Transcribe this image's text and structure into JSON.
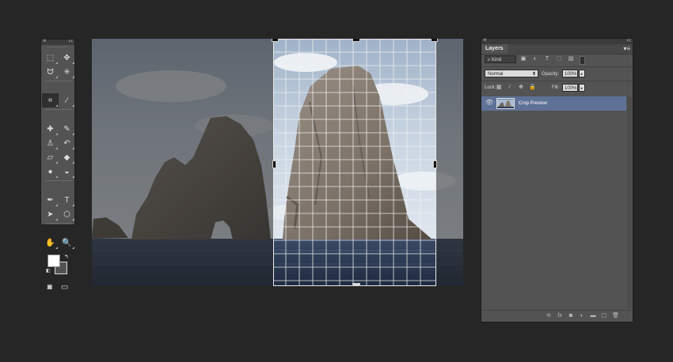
{
  "tools_panel": {
    "close_glyph": "×",
    "collapse_glyph": "‹‹",
    "tools": [
      {
        "name": "rectangular-marquee-tool",
        "glyph": "⬚"
      },
      {
        "name": "move-tool",
        "glyph": "✥"
      },
      {
        "name": "lasso-tool",
        "glyph": "ᗢ"
      },
      {
        "name": "magic-wand-tool",
        "glyph": "✳"
      },
      {
        "name": "crop-tool",
        "glyph": "⌗",
        "active": true
      },
      {
        "name": "eyedropper-tool",
        "glyph": "⁄"
      },
      {
        "name": "spot-healing-brush-tool",
        "glyph": "✚"
      },
      {
        "name": "brush-tool",
        "glyph": "✎"
      },
      {
        "name": "clone-stamp-tool",
        "glyph": "♙"
      },
      {
        "name": "history-brush-tool",
        "glyph": "↶"
      },
      {
        "name": "eraser-tool",
        "glyph": "▱"
      },
      {
        "name": "paint-bucket-tool",
        "glyph": "◆"
      },
      {
        "name": "blur-tool",
        "glyph": "●"
      },
      {
        "name": "dodge-tool",
        "glyph": "◒"
      },
      {
        "name": "pen-tool",
        "glyph": "✒"
      },
      {
        "name": "type-tool",
        "glyph": "T"
      },
      {
        "name": "path-selection-tool",
        "glyph": "➤"
      },
      {
        "name": "shape-tool",
        "glyph": "⬡"
      },
      {
        "name": "hand-tool",
        "glyph": "✋"
      },
      {
        "name": "zoom-tool",
        "glyph": "🔍"
      }
    ],
    "foreground_color": "#ffffff",
    "background_color": "#535353",
    "bottom_tools": [
      {
        "name": "quick-mask-icon",
        "glyph": "◙"
      },
      {
        "name": "screen-mode-icon",
        "glyph": "▭"
      }
    ]
  },
  "canvas": {
    "image": "sea stacks with cloudy sky",
    "crop_overlay": "rule of thirds grid"
  },
  "layers_panel": {
    "close_glyph": "×",
    "collapse_glyph": "‹‹",
    "tab_label": "Layers",
    "menu_glyph": "▾≡",
    "filter_label": "⌕ Kind",
    "filter_icons": [
      {
        "name": "pixel-filter-icon",
        "glyph": "▣"
      },
      {
        "name": "adjustment-filter-icon",
        "glyph": "◐"
      },
      {
        "name": "type-filter-icon",
        "glyph": "T"
      },
      {
        "name": "shape-filter-icon",
        "glyph": "⬚"
      },
      {
        "name": "smart-object-filter-icon",
        "glyph": "▤"
      }
    ],
    "blend_mode": "Normal",
    "opacity_label": "Opacity:",
    "opacity_value": "100%",
    "lock_label": "Lock:",
    "lock_icons": [
      {
        "name": "lock-transparent-icon",
        "glyph": "▦"
      },
      {
        "name": "lock-image-icon",
        "glyph": "⁄"
      },
      {
        "name": "lock-position-icon",
        "glyph": "✥"
      },
      {
        "name": "lock-all-icon",
        "glyph": "🔒"
      }
    ],
    "fill_label": "Fill:",
    "fill_value": "100%",
    "layers": [
      {
        "name": "Crop Preview",
        "visible_glyph": "👁"
      }
    ],
    "footer_icons": [
      {
        "name": "link-layers-icon",
        "glyph": "⊖"
      },
      {
        "name": "layer-style-icon",
        "glyph": "fx"
      },
      {
        "name": "add-mask-icon",
        "glyph": "◙"
      },
      {
        "name": "adjustment-layer-icon",
        "glyph": "◐"
      },
      {
        "name": "new-group-icon",
        "glyph": "▬"
      },
      {
        "name": "new-layer-icon",
        "glyph": "▢"
      },
      {
        "name": "delete-layer-icon",
        "glyph": "🗑"
      }
    ]
  }
}
